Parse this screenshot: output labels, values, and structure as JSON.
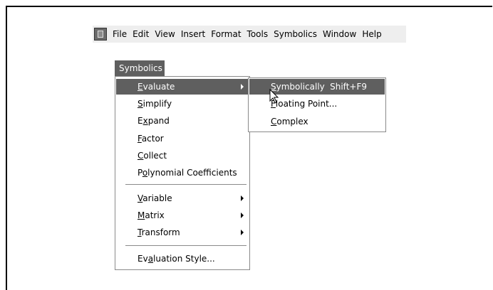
{
  "menubar": {
    "items": [
      "File",
      "Edit",
      "View",
      "Insert",
      "Format",
      "Tools",
      "Symbolics",
      "Window",
      "Help"
    ]
  },
  "menu_title": "Symbolics",
  "menu": {
    "items": [
      {
        "pre": "",
        "u": "E",
        "post": "valuate"
      },
      {
        "pre": "",
        "u": "S",
        "post": "implify"
      },
      {
        "pre": "E",
        "u": "x",
        "post": "pand"
      },
      {
        "pre": "",
        "u": "F",
        "post": "actor"
      },
      {
        "pre": "",
        "u": "C",
        "post": "ollect"
      },
      {
        "pre": "P",
        "u": "o",
        "post": "lynomial Coefficients"
      },
      {
        "pre": "",
        "u": "V",
        "post": "ariable"
      },
      {
        "pre": "",
        "u": "M",
        "post": "atrix"
      },
      {
        "pre": "",
        "u": "T",
        "post": "ransform"
      },
      {
        "pre": "Ev",
        "u": "a",
        "post": "luation Style..."
      }
    ]
  },
  "submenu": {
    "items": [
      {
        "pre": "",
        "u": "S",
        "post": "ymbolically",
        "shortcut": "Shift+F9"
      },
      {
        "pre": "",
        "u": "F",
        "post": "loating Point...",
        "shortcut": ""
      },
      {
        "pre": "",
        "u": "C",
        "post": "omplex",
        "shortcut": ""
      }
    ]
  },
  "colors": {
    "highlight": "#5f5f5f",
    "menubar_bg": "#eeeeee"
  }
}
